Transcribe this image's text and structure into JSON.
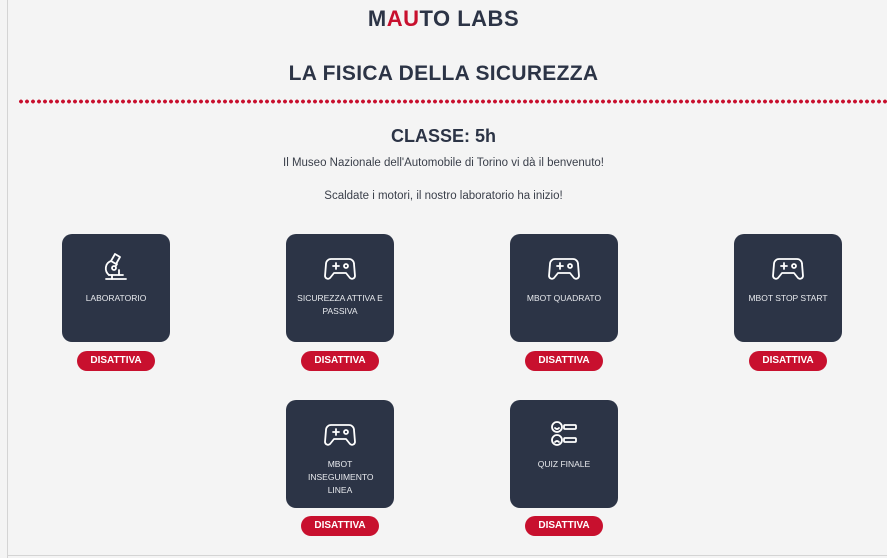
{
  "header": {
    "logo_prefix": "M",
    "logo_accent": "AU",
    "logo_suffix": "TO LABS",
    "title": "LA FISICA DELLA SICUREZZA"
  },
  "intro": {
    "classe": "CLASSE: 5h",
    "welcome": "Il Museo Nazionale dell'Automobile di Torino vi dà il benvenuto!",
    "start": "Scaldate i motori, il nostro laboratorio ha inizio!"
  },
  "colors": {
    "accent": "#c8102e",
    "card": "#2c3446",
    "background": "#f4f4f4"
  },
  "activities": [
    {
      "label": "LABORATORIO",
      "icon": "microscope-icon",
      "button": "DISATTIVA"
    },
    {
      "label": "SICUREZZA ATTIVA E PASSIVA",
      "icon": "gamepad-icon",
      "button": "DISATTIVA"
    },
    {
      "label": "MBOT QUADRATO",
      "icon": "gamepad-icon",
      "button": "DISATTIVA"
    },
    {
      "label": "MBOT STOP START",
      "icon": "gamepad-icon",
      "button": "DISATTIVA"
    },
    {
      "label": "MBOT INSEGUIMENTO LINEA",
      "icon": "gamepad-icon",
      "button": "DISATTIVA"
    },
    {
      "label": "QUIZ FINALE",
      "icon": "quiz-icon",
      "button": "DISATTIVA"
    }
  ]
}
